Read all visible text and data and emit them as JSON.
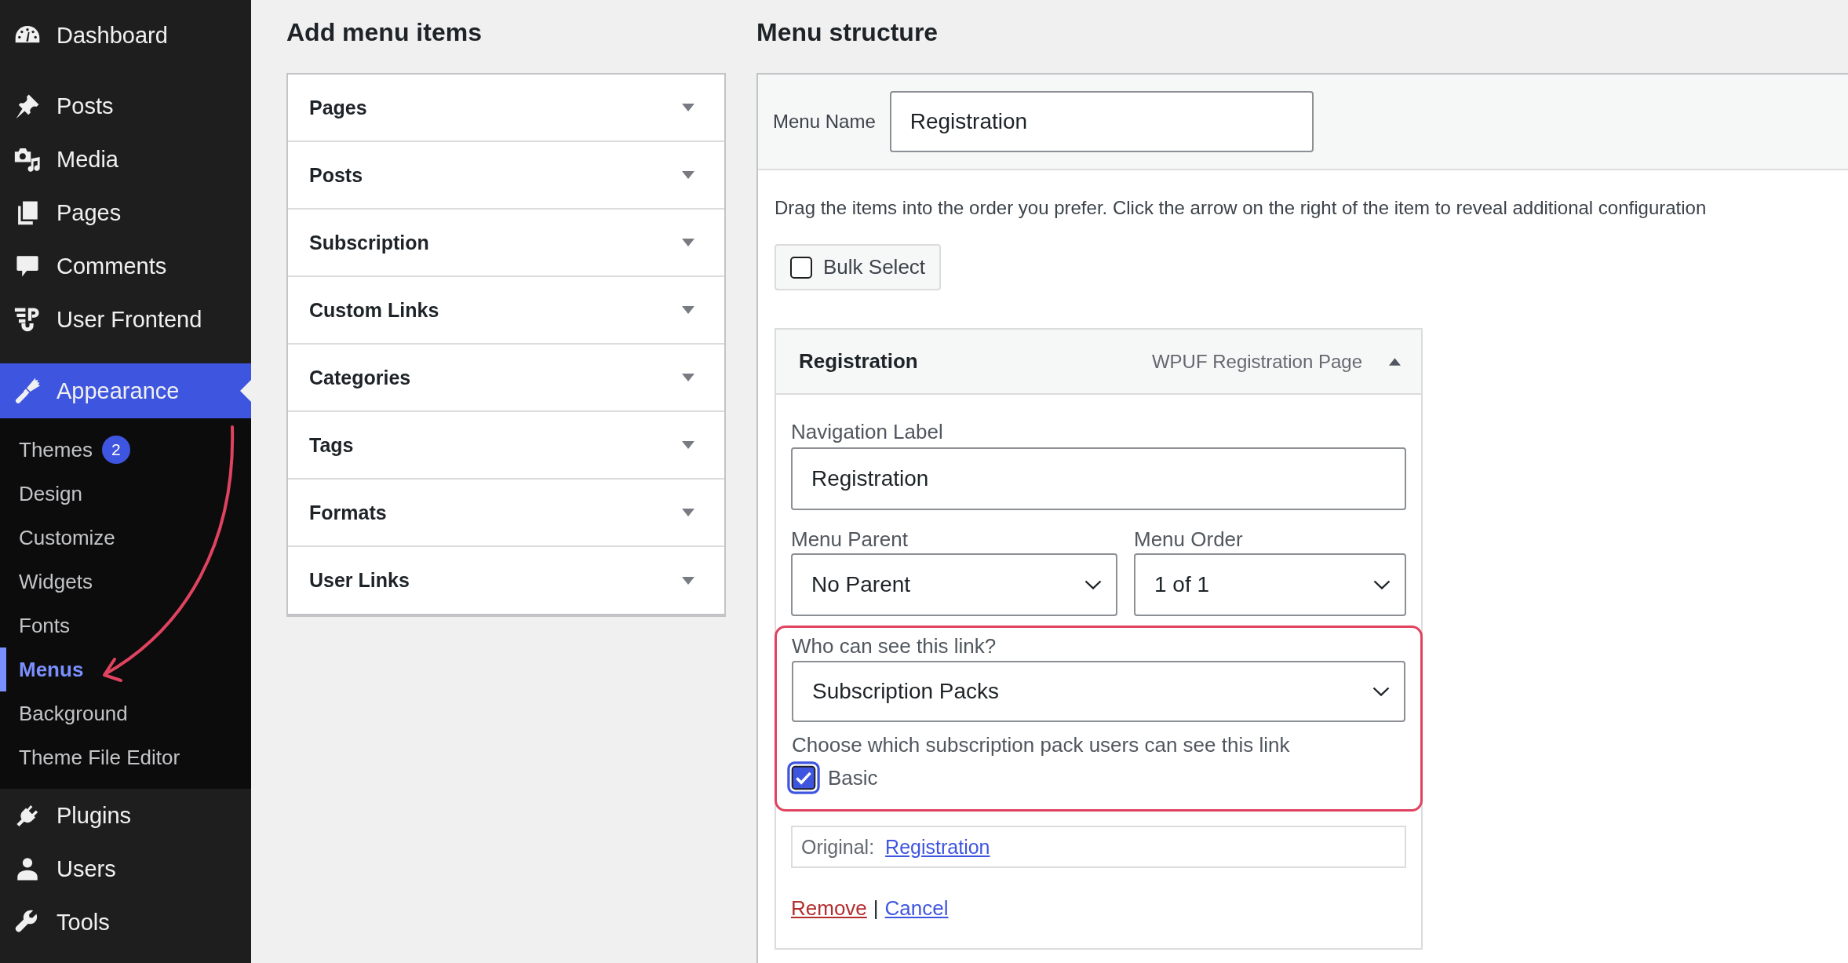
{
  "sidebar": {
    "sections": [
      {
        "items": [
          {
            "label": "Dashboard",
            "selected": false
          }
        ]
      },
      {
        "items": [
          {
            "label": "Posts",
            "selected": false
          },
          {
            "label": "Media",
            "selected": false
          },
          {
            "label": "Pages",
            "selected": false
          },
          {
            "label": "Comments",
            "selected": false
          },
          {
            "label": "User Frontend",
            "selected": false
          }
        ]
      },
      {
        "items": [
          {
            "label": "Appearance",
            "selected": true,
            "children": [
              {
                "label": "Themes",
                "badge": "2",
                "selected": false
              },
              {
                "label": "Design",
                "selected": false
              },
              {
                "label": "Customize",
                "selected": false
              },
              {
                "label": "Widgets",
                "selected": false
              },
              {
                "label": "Fonts",
                "selected": false
              },
              {
                "label": "Menus",
                "selected": true
              },
              {
                "label": "Background",
                "selected": false
              },
              {
                "label": "Theme File Editor",
                "selected": false
              }
            ]
          },
          {
            "label": "Plugins",
            "selected": false
          },
          {
            "label": "Users",
            "selected": false
          },
          {
            "label": "Tools",
            "selected": false
          }
        ]
      }
    ]
  },
  "add_menu_items": {
    "title": "Add menu items",
    "sections": [
      {
        "label": "Pages",
        "expanded": false
      },
      {
        "label": "Posts",
        "expanded": false
      },
      {
        "label": "Subscription",
        "expanded": false
      },
      {
        "label": "Custom Links",
        "expanded": false
      },
      {
        "label": "Categories",
        "expanded": false
      },
      {
        "label": "Tags",
        "expanded": false
      },
      {
        "label": "Formats",
        "expanded": false
      },
      {
        "label": "User Links",
        "expanded": false
      }
    ]
  },
  "menu_structure": {
    "title": "Menu structure",
    "menu_name": {
      "label": "Menu Name",
      "value": "Registration"
    },
    "instructions": "Drag the items into the order you prefer. Click the arrow on the right of the item to reveal additional configuration",
    "bulk_select": {
      "label": "Bulk Select",
      "checked": false
    },
    "items": [
      {
        "title": "Registration",
        "type": "WPUF Registration Page",
        "expanded": true,
        "navigation_label": {
          "label": "Navigation Label",
          "value": "Registration"
        },
        "menu_parent": {
          "label": "Menu Parent",
          "value": "No Parent"
        },
        "menu_order": {
          "label": "Menu Order",
          "value": "1 of 1"
        },
        "visibility": {
          "label": "Who can see this link?",
          "value": "Subscription Packs",
          "hint": "Choose which subscription pack users can see this link",
          "packs": [
            {
              "label": "Basic",
              "checked": true
            }
          ]
        },
        "original": {
          "label": "Original:",
          "link": "Registration"
        },
        "actions": [
          {
            "label": "Remove",
            "kind": "delete"
          },
          {
            "label": "Cancel",
            "kind": "cancel"
          }
        ],
        "action_separator": "|"
      }
    ]
  }
}
